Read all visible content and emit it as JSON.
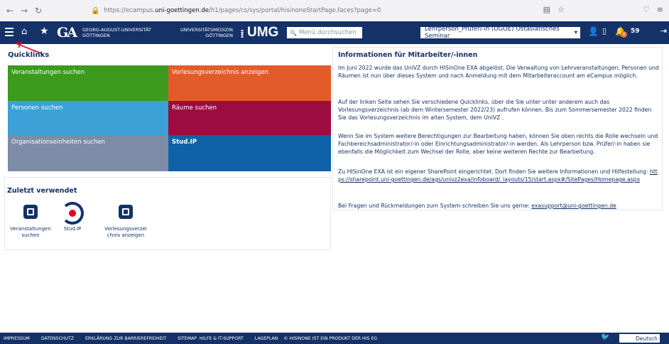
{
  "browser": {
    "url_prefix": "https://ecampus.",
    "url_domain": "uni-goettingen.de",
    "url_suffix": "/h1/pages/cs/sys/portal/hisinoneStartPage.faces?page=0"
  },
  "header": {
    "university_line1": "GEORG-AUGUST-UNIVERSITÄT",
    "university_line2": "GÖTTINGEN",
    "umg_small_line1": "UNIVERSITÄTSMEDIZIN",
    "umg_small_line2": "GÖTTINGEN",
    "umg_logo": "UMG",
    "logo_ga": "GA",
    "search_placeholder": "Menü durchsuchen",
    "role": "Lehrperson_Prüfer/-in (UGOE) Ostasiatisches Seminar",
    "notification_count": "0",
    "timer": "59"
  },
  "quicklinks": {
    "title": "Quicklinks",
    "tiles": [
      {
        "label": "Veranstaltungen suchen",
        "color": "#3c9a1e"
      },
      {
        "label": "Vorlesungsverzeichnis anzeigen",
        "color": "#e35b2b"
      },
      {
        "label": "Personen suchen",
        "color": "#3ba1d7"
      },
      {
        "label": "Räume suchen",
        "color": "#9c0c3e"
      },
      {
        "label": "Organisationseinheiten suchen",
        "color": "#7d8ba6"
      },
      {
        "label": "Stud.IP",
        "color": "#0f62a6"
      }
    ]
  },
  "recent": {
    "title": "Zuletzt verwendet",
    "items": [
      {
        "label_line1": "Veranstaltungen",
        "label_line2": "suchen"
      },
      {
        "label_line1": "Stud.IP",
        "label_line2": ""
      },
      {
        "label_line1": "Vorlesungsverzei",
        "label_line2": "chnis anzeigen"
      }
    ]
  },
  "info": {
    "title": "Informationen für Mitarbeiter/-innen",
    "p1": "Im Juni 2022 wurde das UniVZ durch HISinOne EXA abgelöst. Die Verwaltung von Lehrveranstaltungen, Personen und Räumen ist nun über dieses System und nach Anmeldung mit dem Mitarbeiteraccount am eCampus möglich.",
    "p2": "Auf der linken Seite sehen Sie verschiedene Quicklinks, über die Sie unter unter anderem auch das Vorlesungsverzeichnis (ab dem Wintersemester 2022/23) aufrufen können. Bis zum Sommersemester 2022 finden Sie das Vorlesungsverzeichnis im alten System, dem UniVZ .",
    "p3": "Wenn Sie im System weitere Berechtigungen zur Bearbeitung haben, können Sie oben rechts die Rolle wechseln und Fachbereichsadministrator/-in oder Einrichtungsadministrator/-in werden. Als Lehrperson bzw. Prüfer/-in haben sie ebenfalls die Möglichkeit zum Wechsel der Rolle, aber keine weiteren Rechte zur Bearbeitung.",
    "p4_text": "Zu HISinOne EXA ist ein eigener SharePoint eingerichtet. Dort finden Sie weitere Informationen und Hilfestellung: ",
    "p4_link": "https://sharepoint.uni-goettingen.de/ags/univz2exa/infoboard/_layouts/15/start.aspx#/SitePages/Homepage.aspx",
    "p5_text": "Bei Fragen und Rückmeldungen zum System schreiben Sie uns gerne: ",
    "p5_link": "exasupport@uni-goettingen.de"
  },
  "footer": {
    "links": [
      "IMPRESSUM",
      "DATENSCHUTZ",
      "ERKLÄRUNG ZUR BARRIEREFREIHEIT",
      "SITEMAP",
      "HILFE & IT-SUPPORT",
      "LAGEPLAN",
      "© HISINONE IST EIN PRODUKT DER HIS EG"
    ],
    "language": "Deutsch"
  }
}
